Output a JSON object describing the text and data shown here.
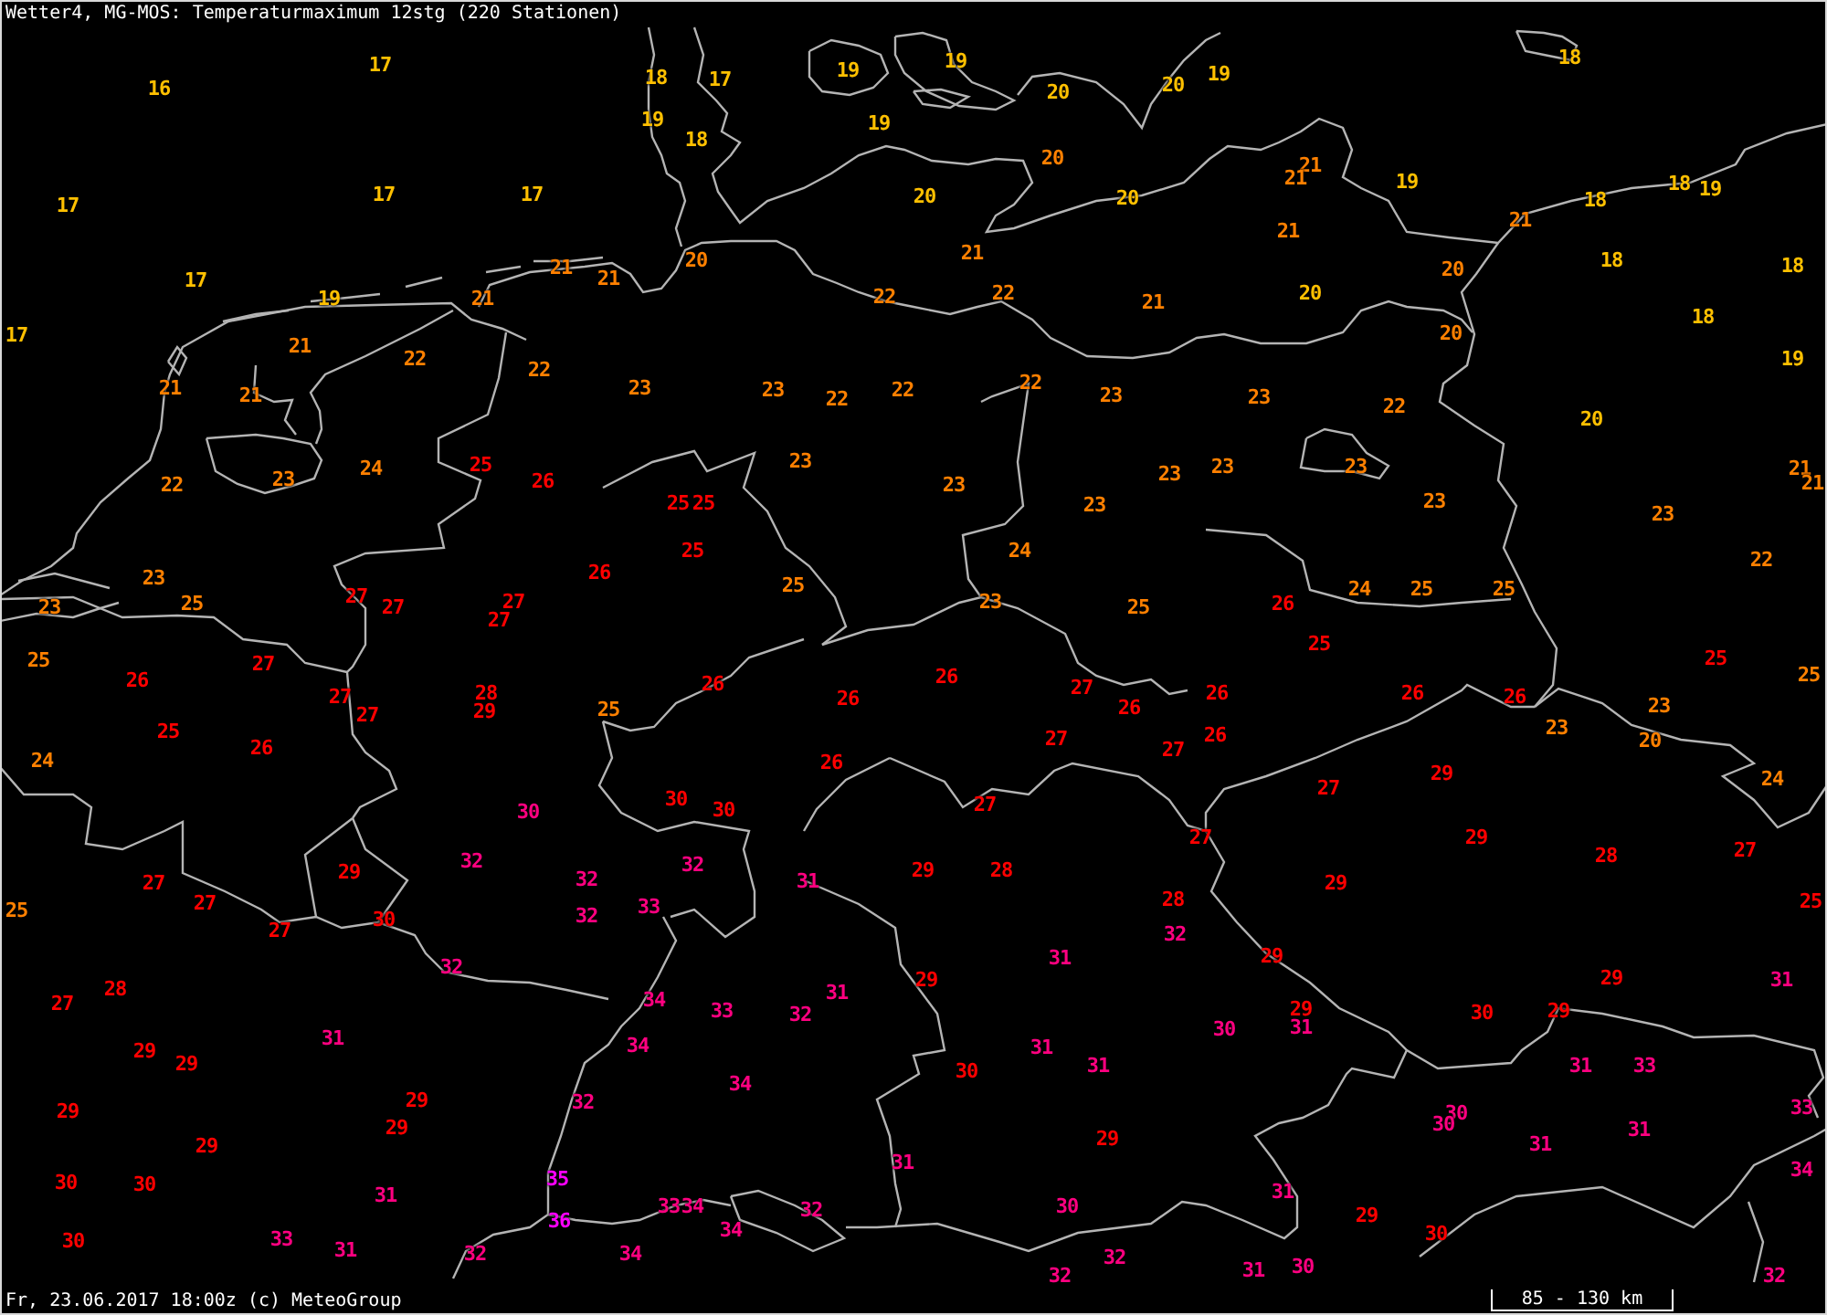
{
  "title": "Wetter4, MG-MOS: Temperaturmaximum 12stg (220 Stationen)",
  "stations": [
    {
      "value": "17",
      "color": "#ffc000"
    },
    {
      "value": "19",
      "color": "#ffc000"
    },
    {
      "value": "18",
      "color": "#ffc000"
    },
    {
      "value": "18",
      "color": "#ffc000"
    },
    {
      "value": "17",
      "color": "#ffc000"
    },
    {
      "value": "19",
      "color": "#ffc000"
    },
    {
      "value": "19",
      "color": "#ffc000"
    },
    {
      "value": "16",
      "color": "#ffc000"
    },
    {
      "value": "20",
      "color": "#ffc000"
    },
    {
      "value": "20",
      "color": "#ffc000"
    },
    {
      "value": "19",
      "color": "#ffc000"
    },
    {
      "value": "19",
      "color": "#ffc000"
    },
    {
      "value": "18",
      "color": "#ffc000"
    },
    {
      "value": "20",
      "color": "#ff8000"
    },
    {
      "value": "21",
      "color": "#ff8000"
    },
    {
      "value": "21",
      "color": "#ff8000"
    },
    {
      "value": "19",
      "color": "#ffc000"
    },
    {
      "value": "18",
      "color": "#ffc000"
    },
    {
      "value": "17",
      "color": "#ffc000"
    },
    {
      "value": "17",
      "color": "#ffc000"
    },
    {
      "value": "20",
      "color": "#ffc000"
    },
    {
      "value": "20",
      "color": "#ffc000"
    },
    {
      "value": "18",
      "color": "#ffc000"
    },
    {
      "value": "19",
      "color": "#ffc000"
    },
    {
      "value": "17",
      "color": "#ffc000"
    },
    {
      "value": "21",
      "color": "#ff8000"
    },
    {
      "value": "21",
      "color": "#ff8000"
    },
    {
      "value": "21",
      "color": "#ff8000"
    },
    {
      "value": "21",
      "color": "#ff8000"
    },
    {
      "value": "20",
      "color": "#ff8000"
    },
    {
      "value": "20",
      "color": "#ff8000"
    },
    {
      "value": "18",
      "color": "#ffc000"
    },
    {
      "value": "18",
      "color": "#ffc000"
    },
    {
      "value": "17",
      "color": "#ffc000"
    },
    {
      "value": "21",
      "color": "#ff8000"
    },
    {
      "value": "19",
      "color": "#ffc000"
    },
    {
      "value": "21",
      "color": "#ff8000"
    },
    {
      "value": "22",
      "color": "#ff8000"
    },
    {
      "value": "22",
      "color": "#ff8000"
    },
    {
      "value": "21",
      "color": "#ff8000"
    },
    {
      "value": "20",
      "color": "#ffc000"
    },
    {
      "value": "18",
      "color": "#ffc000"
    },
    {
      "value": "17",
      "color": "#ffc000"
    },
    {
      "value": "20",
      "color": "#ff8000"
    },
    {
      "value": "21",
      "color": "#ff8000"
    },
    {
      "value": "22",
      "color": "#ff8000"
    },
    {
      "value": "19",
      "color": "#ffc000"
    },
    {
      "value": "22",
      "color": "#ff8000"
    },
    {
      "value": "21",
      "color": "#ff8000"
    },
    {
      "value": "21",
      "color": "#ff8000"
    },
    {
      "value": "23",
      "color": "#ff8000"
    },
    {
      "value": "23",
      "color": "#ff8000"
    },
    {
      "value": "22",
      "color": "#ff8000"
    },
    {
      "value": "22",
      "color": "#ff8000"
    },
    {
      "value": "22",
      "color": "#ff8000"
    },
    {
      "value": "23",
      "color": "#ff8000"
    },
    {
      "value": "23",
      "color": "#ff8000"
    },
    {
      "value": "22",
      "color": "#ff8000"
    },
    {
      "value": "20",
      "color": "#ffc000"
    },
    {
      "value": "24",
      "color": "#ff8000"
    },
    {
      "value": "25",
      "color": "#ff0000"
    },
    {
      "value": "23",
      "color": "#ff8000"
    },
    {
      "value": "23",
      "color": "#ff8000"
    },
    {
      "value": "23",
      "color": "#ff8000"
    },
    {
      "value": "23",
      "color": "#ff8000"
    },
    {
      "value": "21",
      "color": "#ff8000"
    },
    {
      "value": "22",
      "color": "#ff8000"
    },
    {
      "value": "23",
      "color": "#ff8000"
    },
    {
      "value": "26",
      "color": "#ff0000"
    },
    {
      "value": "23",
      "color": "#ff8000"
    },
    {
      "value": "21",
      "color": "#ff8000"
    },
    {
      "value": "25",
      "color": "#ff0000"
    },
    {
      "value": "25",
      "color": "#ff0000"
    },
    {
      "value": "23",
      "color": "#ff8000"
    },
    {
      "value": "23",
      "color": "#ff8000"
    },
    {
      "value": "23",
      "color": "#ff8000"
    },
    {
      "value": "25",
      "color": "#ff0000"
    },
    {
      "value": "24",
      "color": "#ff8000"
    },
    {
      "value": "22",
      "color": "#ff8000"
    },
    {
      "value": "23",
      "color": "#ff8000"
    },
    {
      "value": "26",
      "color": "#ff0000"
    },
    {
      "value": "23",
      "color": "#ff8000"
    },
    {
      "value": "25",
      "color": "#ff8000"
    },
    {
      "value": "27",
      "color": "#ff0000"
    },
    {
      "value": "27",
      "color": "#ff0000"
    },
    {
      "value": "27",
      "color": "#ff0000"
    },
    {
      "value": "25",
      "color": "#ff8000"
    },
    {
      "value": "23",
      "color": "#ff8000"
    },
    {
      "value": "25",
      "color": "#ff8000"
    },
    {
      "value": "26",
      "color": "#ff0000"
    },
    {
      "value": "24",
      "color": "#ff8000"
    },
    {
      "value": "25",
      "color": "#ff8000"
    },
    {
      "value": "25",
      "color": "#ff8000"
    },
    {
      "value": "27",
      "color": "#ff0000"
    },
    {
      "value": "25",
      "color": "#ff0000"
    },
    {
      "value": "25",
      "color": "#ff8000"
    },
    {
      "value": "27",
      "color": "#ff0000"
    },
    {
      "value": "25",
      "color": "#ff0000"
    },
    {
      "value": "26",
      "color": "#ff0000"
    },
    {
      "value": "26",
      "color": "#ff0000"
    },
    {
      "value": "26",
      "color": "#ff0000"
    },
    {
      "value": "27",
      "color": "#ff0000"
    },
    {
      "value": "25",
      "color": "#ff8000"
    },
    {
      "value": "27",
      "color": "#ff0000"
    },
    {
      "value": "28",
      "color": "#ff0000"
    },
    {
      "value": "26",
      "color": "#ff0000"
    },
    {
      "value": "26",
      "color": "#ff0000"
    },
    {
      "value": "26",
      "color": "#ff0000"
    },
    {
      "value": "26",
      "color": "#ff0000"
    },
    {
      "value": "27",
      "color": "#ff0000"
    },
    {
      "value": "29",
      "color": "#ff0000"
    },
    {
      "value": "25",
      "color": "#ff8000"
    },
    {
      "value": "26",
      "color": "#ff0000"
    },
    {
      "value": "23",
      "color": "#ff8000"
    },
    {
      "value": "25",
      "color": "#ff0000"
    },
    {
      "value": "26",
      "color": "#ff0000"
    },
    {
      "value": "27",
      "color": "#ff0000"
    },
    {
      "value": "27",
      "color": "#ff0000"
    },
    {
      "value": "26",
      "color": "#ff0000"
    },
    {
      "value": "23",
      "color": "#ff8000"
    },
    {
      "value": "20",
      "color": "#ff8000"
    },
    {
      "value": "24",
      "color": "#ff8000"
    },
    {
      "value": "26",
      "color": "#ff0000"
    },
    {
      "value": "27",
      "color": "#ff0000"
    },
    {
      "value": "29",
      "color": "#ff0000"
    },
    {
      "value": "24",
      "color": "#ff8000"
    },
    {
      "value": "30",
      "color": "#ff0080"
    },
    {
      "value": "30",
      "color": "#ff0000"
    },
    {
      "value": "30",
      "color": "#ff0000"
    },
    {
      "value": "27",
      "color": "#ff0000"
    },
    {
      "value": "27",
      "color": "#ff0000"
    },
    {
      "value": "29",
      "color": "#ff0000"
    },
    {
      "value": "28",
      "color": "#ff0000"
    },
    {
      "value": "27",
      "color": "#ff0000"
    },
    {
      "value": "29",
      "color": "#ff0000"
    },
    {
      "value": "32",
      "color": "#ff0080"
    },
    {
      "value": "32",
      "color": "#ff0080"
    },
    {
      "value": "29",
      "color": "#ff0000"
    },
    {
      "value": "28",
      "color": "#ff0000"
    },
    {
      "value": "27",
      "color": "#ff0000"
    },
    {
      "value": "32",
      "color": "#ff0080"
    },
    {
      "value": "31",
      "color": "#ff0080"
    },
    {
      "value": "29",
      "color": "#ff0000"
    },
    {
      "value": "25",
      "color": "#ff8000"
    },
    {
      "value": "27",
      "color": "#ff0000"
    },
    {
      "value": "33",
      "color": "#ff0080"
    },
    {
      "value": "28",
      "color": "#ff0000"
    },
    {
      "value": "25",
      "color": "#ff0000"
    },
    {
      "value": "30",
      "color": "#ff0000"
    },
    {
      "value": "32",
      "color": "#ff0080"
    },
    {
      "value": "27",
      "color": "#ff0000"
    },
    {
      "value": "32",
      "color": "#ff0080"
    },
    {
      "value": "31",
      "color": "#ff0080"
    },
    {
      "value": "29",
      "color": "#ff0000"
    },
    {
      "value": "32",
      "color": "#ff0080"
    },
    {
      "value": "29",
      "color": "#ff0000"
    },
    {
      "value": "29",
      "color": "#ff0000"
    },
    {
      "value": "31",
      "color": "#ff0080"
    },
    {
      "value": "27",
      "color": "#ff0000"
    },
    {
      "value": "28",
      "color": "#ff0000"
    },
    {
      "value": "34",
      "color": "#ff0080"
    },
    {
      "value": "31",
      "color": "#ff0080"
    },
    {
      "value": "33",
      "color": "#ff0080"
    },
    {
      "value": "32",
      "color": "#ff0080"
    },
    {
      "value": "29",
      "color": "#ff0000"
    },
    {
      "value": "30",
      "color": "#ff0000"
    },
    {
      "value": "29",
      "color": "#ff0000"
    },
    {
      "value": "30",
      "color": "#ff0080"
    },
    {
      "value": "31",
      "color": "#ff0080"
    },
    {
      "value": "29",
      "color": "#ff0000"
    },
    {
      "value": "31",
      "color": "#ff0080"
    },
    {
      "value": "34",
      "color": "#ff0080"
    },
    {
      "value": "31",
      "color": "#ff0080"
    },
    {
      "value": "29",
      "color": "#ff0000"
    },
    {
      "value": "30",
      "color": "#ff0000"
    },
    {
      "value": "31",
      "color": "#ff0080"
    },
    {
      "value": "31",
      "color": "#ff0080"
    },
    {
      "value": "33",
      "color": "#ff0080"
    },
    {
      "value": "34",
      "color": "#ff0080"
    },
    {
      "value": "29",
      "color": "#ff0000"
    },
    {
      "value": "29",
      "color": "#ff0000"
    },
    {
      "value": "32",
      "color": "#ff0080"
    },
    {
      "value": "30",
      "color": "#ff0080"
    },
    {
      "value": "33",
      "color": "#ff0080"
    },
    {
      "value": "29",
      "color": "#ff0000"
    },
    {
      "value": "30",
      "color": "#ff0080"
    },
    {
      "value": "31",
      "color": "#ff0080"
    },
    {
      "value": "29",
      "color": "#ff0000"
    },
    {
      "value": "29",
      "color": "#ff0000"
    },
    {
      "value": "31",
      "color": "#ff0080"
    },
    {
      "value": "31",
      "color": "#ff0080"
    },
    {
      "value": "34",
      "color": "#ff0080"
    },
    {
      "value": "30",
      "color": "#ff0000"
    },
    {
      "value": "30",
      "color": "#ff0000"
    },
    {
      "value": "31",
      "color": "#ff0080"
    },
    {
      "value": "35",
      "color": "#ff00ff"
    },
    {
      "value": "31",
      "color": "#ff0080"
    },
    {
      "value": "36",
      "color": "#ff00ff"
    },
    {
      "value": "33",
      "color": "#ff0080"
    },
    {
      "value": "34",
      "color": "#ff0080"
    },
    {
      "value": "32",
      "color": "#ff0080"
    },
    {
      "value": "30",
      "color": "#ff0080"
    },
    {
      "value": "29",
      "color": "#ff0000"
    },
    {
      "value": "30",
      "color": "#ff0000"
    },
    {
      "value": "33",
      "color": "#ff0080"
    },
    {
      "value": "34",
      "color": "#ff0080"
    },
    {
      "value": "30",
      "color": "#ff0000"
    },
    {
      "value": "31",
      "color": "#ff0080"
    },
    {
      "value": "32",
      "color": "#ff0080"
    },
    {
      "value": "34",
      "color": "#ff0080"
    },
    {
      "value": "32",
      "color": "#ff0080"
    },
    {
      "value": "32",
      "color": "#ff0080"
    },
    {
      "value": "31",
      "color": "#ff0080"
    },
    {
      "value": "30",
      "color": "#ff0080"
    },
    {
      "value": "32",
      "color": "#ff0080"
    }
  ],
  "scale": "85 - 130 km",
  "timestamp": "Fr, 23.06.2017 18:00z (c) MeteoGroup"
}
